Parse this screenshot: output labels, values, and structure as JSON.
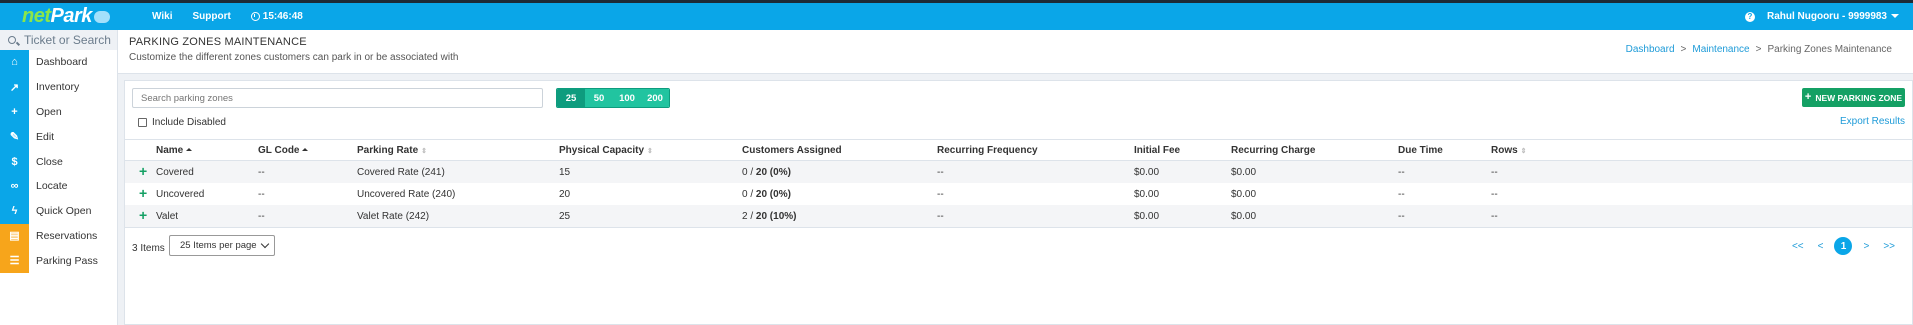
{
  "header": {
    "logo": {
      "net": "net",
      "park": "Park"
    },
    "nav": [
      {
        "label": "Wiki"
      },
      {
        "label": "Support"
      }
    ],
    "clock": "15:46:48",
    "help_glyph": "?",
    "user": "Rahul Nugooru - 9999983"
  },
  "sidebar": {
    "search_placeholder": "Ticket or Search",
    "items": [
      {
        "label": "Dashboard",
        "icon": "home-icon",
        "glyph": "⌂",
        "color": "#0aa6e8"
      },
      {
        "label": "Inventory",
        "icon": "chart-line-icon",
        "glyph": "↗",
        "color": "#0aa6e8"
      },
      {
        "label": "Open",
        "icon": "plus-icon",
        "glyph": "+",
        "color": "#0aa6e8"
      },
      {
        "label": "Edit",
        "icon": "pencil-icon",
        "glyph": "✎",
        "color": "#0aa6e8"
      },
      {
        "label": "Close",
        "icon": "dollar-icon",
        "glyph": "$",
        "color": "#0aa6e8"
      },
      {
        "label": "Locate",
        "icon": "binoculars-icon",
        "glyph": "∞",
        "color": "#0aa6e8"
      },
      {
        "label": "Quick Open",
        "icon": "bolt-icon",
        "glyph": "ϟ",
        "color": "#0aa6e8"
      },
      {
        "label": "Reservations",
        "icon": "file-icon",
        "glyph": "▤",
        "color": "#f7a51b"
      },
      {
        "label": "Parking Pass",
        "icon": "list-icon",
        "glyph": "☰",
        "color": "#f7a51b"
      }
    ]
  },
  "page": {
    "title": "PARKING ZONES MAINTENANCE",
    "subtitle": "Customize the different zones customers can park in or be associated with",
    "breadcrumb": [
      {
        "label": "Dashboard"
      },
      {
        "label": "Maintenance"
      },
      {
        "label": "Parking Zones Maintenance"
      }
    ],
    "breadcrumb_sep": ">"
  },
  "toolbar": {
    "search_placeholder": "Search parking zones",
    "page_sizes": [
      "25",
      "50",
      "100",
      "200"
    ],
    "new_button": "NEW PARKING ZONE",
    "include_disabled": "Include Disabled",
    "export": "Export Results"
  },
  "table": {
    "columns": [
      "Name",
      "GL Code",
      "Parking Rate",
      "Physical Capacity",
      "Customers Assigned",
      "Recurring Frequency",
      "Initial Fee",
      "Recurring Charge",
      "Due Time",
      "Rows"
    ],
    "rows": [
      {
        "name": "Covered",
        "gl": "--",
        "rate": "Covered Rate (241)",
        "capacity": "15",
        "assigned_a": "0 / ",
        "assigned_b": "20 (0%)",
        "freq": "--",
        "fee": "$0.00",
        "charge": "$0.00",
        "due": "--",
        "rows": "--"
      },
      {
        "name": "Uncovered",
        "gl": "--",
        "rate": "Uncovered Rate (240)",
        "capacity": "20",
        "assigned_a": "0 / ",
        "assigned_b": "20 (0%)",
        "freq": "--",
        "fee": "$0.00",
        "charge": "$0.00",
        "due": "--",
        "rows": "--"
      },
      {
        "name": "Valet",
        "gl": "--",
        "rate": "Valet Rate (242)",
        "capacity": "25",
        "assigned_a": "2 / ",
        "assigned_b": "20 (10%)",
        "freq": "--",
        "fee": "$0.00",
        "charge": "$0.00",
        "due": "--",
        "rows": "--"
      }
    ]
  },
  "footer": {
    "count": "3 Items",
    "per_page": "25 Items per page",
    "pager": {
      "first": "<<",
      "prev": "<",
      "current": "1",
      "next": ">",
      "last": ">>"
    }
  }
}
